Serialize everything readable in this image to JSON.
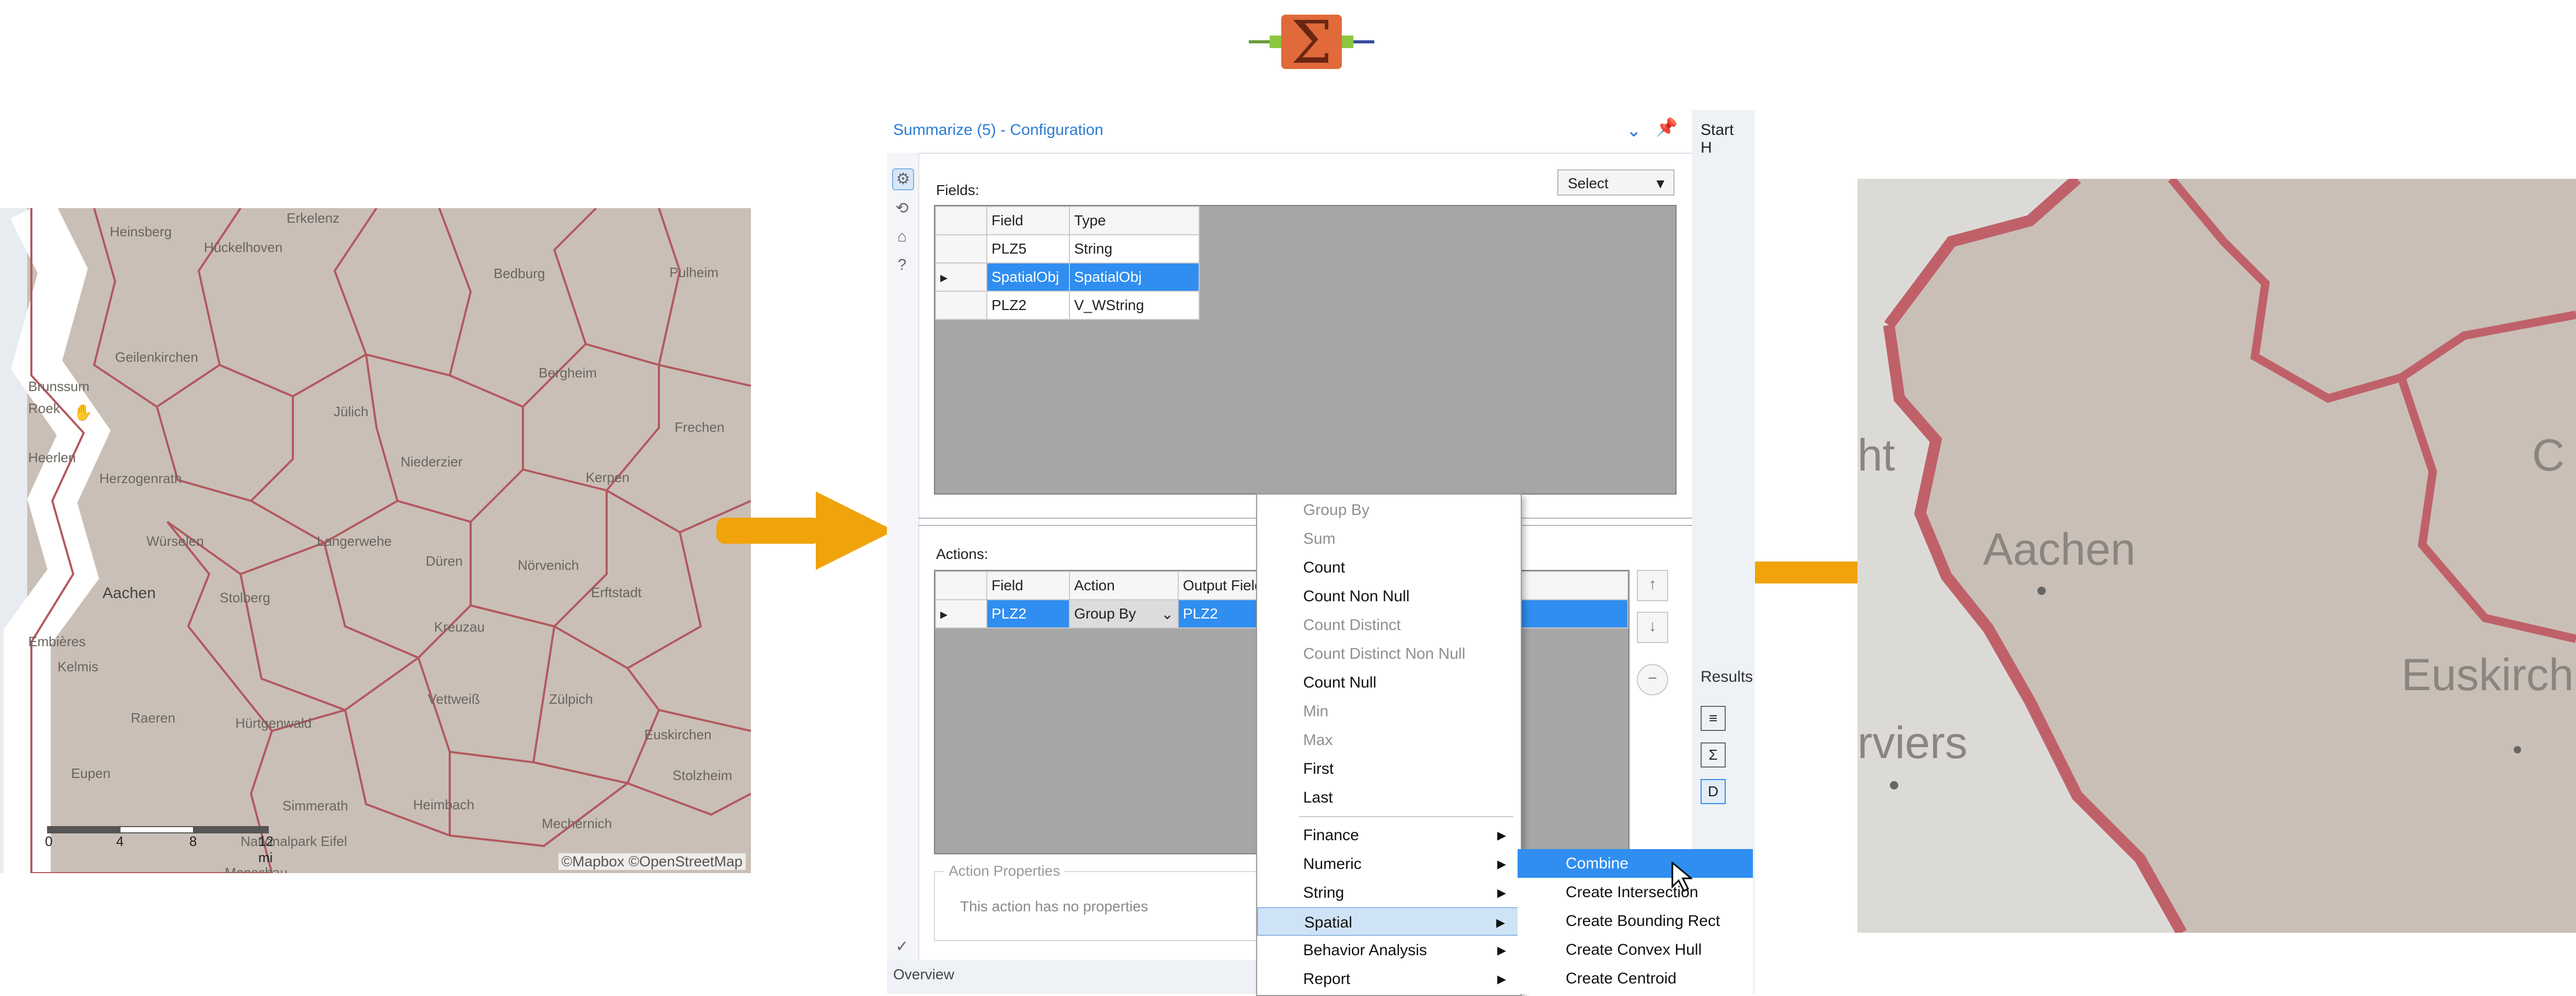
{
  "colors": {
    "accent": "#2f8ef0",
    "title_blue": "#2c7bd6",
    "arrow_orange": "#f0a30a",
    "map_boundary": "#b3585f"
  },
  "tool_icon": "summarize-sigma-icon",
  "left_map": {
    "places": [
      "Erkelenz",
      "Heinsberg",
      "Hückelhoven",
      "Geilenkirchen",
      "Bedburg",
      "Pulheim",
      "Bergheim",
      "Brunssum",
      "Roek",
      "Jülich",
      "Frechen",
      "Heerlen",
      "Herzogenrath",
      "Kerpen",
      "Niederzier",
      "Würselen",
      "Langerwehe",
      "Düren",
      "Aachen",
      "Stolberg",
      "Nörvenich",
      "Erftstadt",
      "Kreuzau",
      "Embières",
      "Kelmis",
      "Raeren",
      "Hürtgenwald",
      "Vettweiß",
      "Zülpich",
      "Euskirchen",
      "Eupen",
      "Monschau",
      "Simmerath",
      "Heimbach",
      "Mechernich",
      "Stolzheim",
      "Nationalpark Eifel"
    ],
    "scale_labels": [
      "0",
      "4",
      "8",
      "12 mi"
    ],
    "attribution": "©Mapbox ©OpenStreetMap"
  },
  "right_map": {
    "places": [
      "Aachen",
      "Euskirch",
      "ht",
      "rviers",
      "C"
    ]
  },
  "config": {
    "title": "Summarize (5) - Configuration",
    "start_here": "Start H",
    "results_tab": "Results",
    "fields_label": "Fields:",
    "select_label": "Select",
    "fields_columns": [
      "Field",
      "Type"
    ],
    "fields_rows": [
      {
        "field": "PLZ5",
        "type": "String"
      },
      {
        "field": "SpatialObj",
        "type": "SpatialObj"
      },
      {
        "field": "PLZ2",
        "type": "V_WString"
      }
    ],
    "actions_label": "Actions:",
    "actions_columns": [
      "Field",
      "Action",
      "Output Field"
    ],
    "actions_rows": [
      {
        "field": "PLZ2",
        "action": "Group By",
        "output": "PLZ2"
      }
    ],
    "action_properties_title": "Action Properties",
    "action_properties_text": "This action has no properties",
    "overview": "Overview"
  },
  "menu": {
    "items": [
      "Group By",
      "Sum",
      "Count",
      "Count Non Null",
      "Count Distinct",
      "Count Distinct Non Null",
      "Count Null",
      "Min",
      "Max",
      "First",
      "Last"
    ],
    "categories": [
      "Finance",
      "Numeric",
      "String",
      "Spatial",
      "Behavior Analysis",
      "Report"
    ],
    "spatial_sub": [
      "Combine",
      "Create Intersection",
      "Create Bounding Rect",
      "Create Convex Hull",
      "Create Centroid"
    ]
  }
}
